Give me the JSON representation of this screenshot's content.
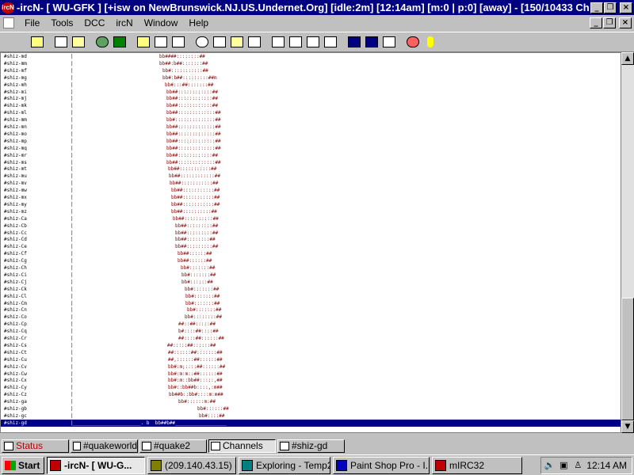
{
  "window": {
    "title": "-ircN- [ WU-GFK ] [+isw on NewBrunswick.NJ.US.Undernet.Org] [idle:2m] [12:14am] [m:0 | p:0] [away] - [150/10433 Channels...",
    "app_icon_text": "ircN",
    "minimize": "_",
    "restore": "❐",
    "close": "×"
  },
  "menu": {
    "items": [
      "File",
      "Tools",
      "DCC",
      "ircN",
      "Window",
      "Help"
    ]
  },
  "toolbar": {
    "icons": [
      "connect-icon",
      "folder-icon",
      "options-icon",
      "address-book-icon",
      "globe-icon",
      "notify-icon",
      "aliases-icon",
      "remote-icon",
      "chat-icon",
      "timer-icon",
      "colors-icon",
      "channel-list-icon",
      "script-icon",
      "dcc-icon",
      "dcc-send-icon",
      "dcc-chat-icon",
      "url-icon",
      "tile-icon",
      "cascade-icon",
      "arrange-icon",
      "help-icon",
      "about-icon"
    ]
  },
  "content": {
    "rows": [
      {
        "nick": "#shiz-md",
        "sep": "|",
        "art": "bb####::::::::##"
      },
      {
        "nick": "#shiz-mm",
        "sep": "|",
        "art": "bb##:b##:::::::##"
      },
      {
        "nick": "#shiz-mf",
        "sep": "|",
        "art": "bb#:::::::::::##"
      },
      {
        "nick": "#shiz-mg",
        "sep": "|",
        "art": "bb#:b##:::::::::##m"
      },
      {
        "nick": "#shiz-mh",
        "sep": "|",
        "art": "bb#:::##:::::::##"
      },
      {
        "nick": "#shiz-mi",
        "sep": "|",
        "art": "bb##::::::::::::##"
      },
      {
        "nick": "#shiz-mj",
        "sep": "|",
        "art": "bb##::::::::::::##"
      },
      {
        "nick": "#shiz-mk",
        "sep": "|",
        "art": "bb##::::::::::::##"
      },
      {
        "nick": "#shiz-ml",
        "sep": "|",
        "art": "bb##:::::::::::::##"
      },
      {
        "nick": "#shiz-mm",
        "sep": "|",
        "art": "bb#::::::::::::::##"
      },
      {
        "nick": "#shiz-mn",
        "sep": "|",
        "art": "bb##:::::::::::::##"
      },
      {
        "nick": "#shiz-mo",
        "sep": "|",
        "art": "bb##:::::::::::::##"
      },
      {
        "nick": "#shiz-mp",
        "sep": "|",
        "art": "bb##:::::::::::::##"
      },
      {
        "nick": "#shiz-mq",
        "sep": "|",
        "art": "bb##:::::::::::::##"
      },
      {
        "nick": "#shiz-mr",
        "sep": "|",
        "art": "bb##::::::::::::##"
      },
      {
        "nick": "#shiz-ms",
        "sep": "|",
        "art": "bb##:::::::::::::##"
      },
      {
        "nick": "#shiz-mt",
        "sep": "|",
        "art": "bb##:::::::::::##"
      },
      {
        "nick": "#shiz-mu",
        "sep": "|",
        "art": "bb##::::::::::::##"
      },
      {
        "nick": "#shiz-mv",
        "sep": "|",
        "art": "bb##:::::::::::##"
      },
      {
        "nick": "#shiz-mw",
        "sep": "|",
        "art": "bb##:::::::::::##"
      },
      {
        "nick": "#shiz-mx",
        "sep": "|",
        "art": "bb##:::::::::::##"
      },
      {
        "nick": "#shiz-my",
        "sep": "|",
        "art": "bb##:::::::::::##"
      },
      {
        "nick": "#shiz-mz",
        "sep": "|",
        "art": "bb##::::::::::##"
      },
      {
        "nick": "#shiz-Ca",
        "sep": "|",
        "art": "bb##::::::::::##"
      },
      {
        "nick": "#shiz-Cb",
        "sep": "|",
        "art": "bb##:::::::::##"
      },
      {
        "nick": "#shiz-Cc",
        "sep": "|",
        "art": "bb##:::::::::##"
      },
      {
        "nick": "#shiz-Cd",
        "sep": "|",
        "art": "bb##::::::::##"
      },
      {
        "nick": "#shiz-Ce",
        "sep": "|",
        "art": "bb##:::::::::##"
      },
      {
        "nick": "#shiz-Cf",
        "sep": "|",
        "art": "bb##::::::##"
      },
      {
        "nick": "#shiz-Cg",
        "sep": "|",
        "art": "bb##::::::##"
      },
      {
        "nick": "#shiz-Ch",
        "sep": "|",
        "art": "bb#:::::::##"
      },
      {
        "nick": "#shiz-Ci",
        "sep": "|",
        "art": "bb#:::::::##"
      },
      {
        "nick": "#shiz-Cj",
        "sep": "|",
        "art": "bb#::::::##"
      },
      {
        "nick": "#shiz-Ck",
        "sep": "|",
        "art": "bb#:::::::##"
      },
      {
        "nick": "#shiz-Cl",
        "sep": "|",
        "art": "bb#:::::::##"
      },
      {
        "nick": "#shiz-Cm",
        "sep": "|",
        "art": "bb#:::::::##"
      },
      {
        "nick": "#shiz-Cn",
        "sep": "|",
        "art": "bb#:::::::##"
      },
      {
        "nick": "#shiz-Co",
        "sep": "|",
        "art": "bb#::::::::##"
      },
      {
        "nick": "#shiz-Cp",
        "sep": "|",
        "art": "##::##:::::##"
      },
      {
        "nick": "#shiz-Cq",
        "sep": "|",
        "art": "b#::::##::::##"
      },
      {
        "nick": "#shiz-Cr",
        "sep": "|",
        "art": "##::::##::::::##"
      },
      {
        "nick": "#shiz-Cs",
        "sep": "|",
        "art": "##:::::##::::::##"
      },
      {
        "nick": "#shiz-Ct",
        "sep": "|",
        "art": "##::::::##:::::::##"
      },
      {
        "nick": "#shiz-Cu",
        "sep": "|",
        "art": "##,::::::##::::::##"
      },
      {
        "nick": "#shiz-Cv",
        "sep": "|",
        "art": "bb#:m;::::##::::::##"
      },
      {
        "nick": "#shiz-Cw",
        "sep": "|",
        "art": "bb#:m:m::##::::::##"
      },
      {
        "nick": "#shiz-Cx",
        "sep": "|",
        "art": "bb#:m::bb##:::::,##"
      },
      {
        "nick": "#shiz-Cy",
        "sep": "|",
        "art": "bb#::bb##b::::,:m##"
      },
      {
        "nick": "#shiz-Cz",
        "sep": "|",
        "art": "bb##b::bb#::::m:m##"
      },
      {
        "nick": "#shiz-ga",
        "sep": "|",
        "art": "bb#::::::m:##"
      },
      {
        "nick": "#shiz-gb",
        "sep": "|",
        "art": "bb#::::::##"
      },
      {
        "nick": "#shiz-gc",
        "sep": "|",
        "art": "bb#::::##"
      },
      {
        "nick": "#shiz-gd",
        "sep": "|",
        "art": "________________________. b  bb##b##__________________"
      }
    ]
  },
  "scrollbar": {
    "up": "▲",
    "down": "▼"
  },
  "switchbar": {
    "buttons": [
      {
        "label": "Status",
        "icon": "status-icon",
        "active": false
      },
      {
        "label": "#quakeworld",
        "icon": "channel-icon",
        "active": false
      },
      {
        "label": "#quake2",
        "icon": "channel-icon",
        "active": false
      },
      {
        "label": "Channels",
        "icon": "channel-list-icon",
        "active": true
      },
      {
        "label": "#shiz-gd",
        "icon": "channel-icon",
        "active": false
      }
    ]
  },
  "taskbar": {
    "start_label": "Start",
    "tasks": [
      {
        "label": "-ircN- [ WU-G...",
        "icon": "ircn-icon",
        "active": true,
        "color": "#c00000"
      },
      {
        "label": "(209.140.43.15) -...",
        "icon": "telnet-icon",
        "active": false,
        "color": "#808000"
      },
      {
        "label": "Exploring - Temp2",
        "icon": "explorer-icon",
        "active": false,
        "color": "#008080"
      },
      {
        "label": "Paint Shop Pro - I...",
        "icon": "paint-icon",
        "active": false,
        "color": "#0000c0"
      },
      {
        "label": "mIRC32",
        "icon": "mirc-icon",
        "active": false,
        "color": "#c00000"
      }
    ],
    "tray_icons": [
      "speaker-icon",
      "network-icon",
      "person-icon"
    ],
    "clock": "12:14 AM"
  }
}
